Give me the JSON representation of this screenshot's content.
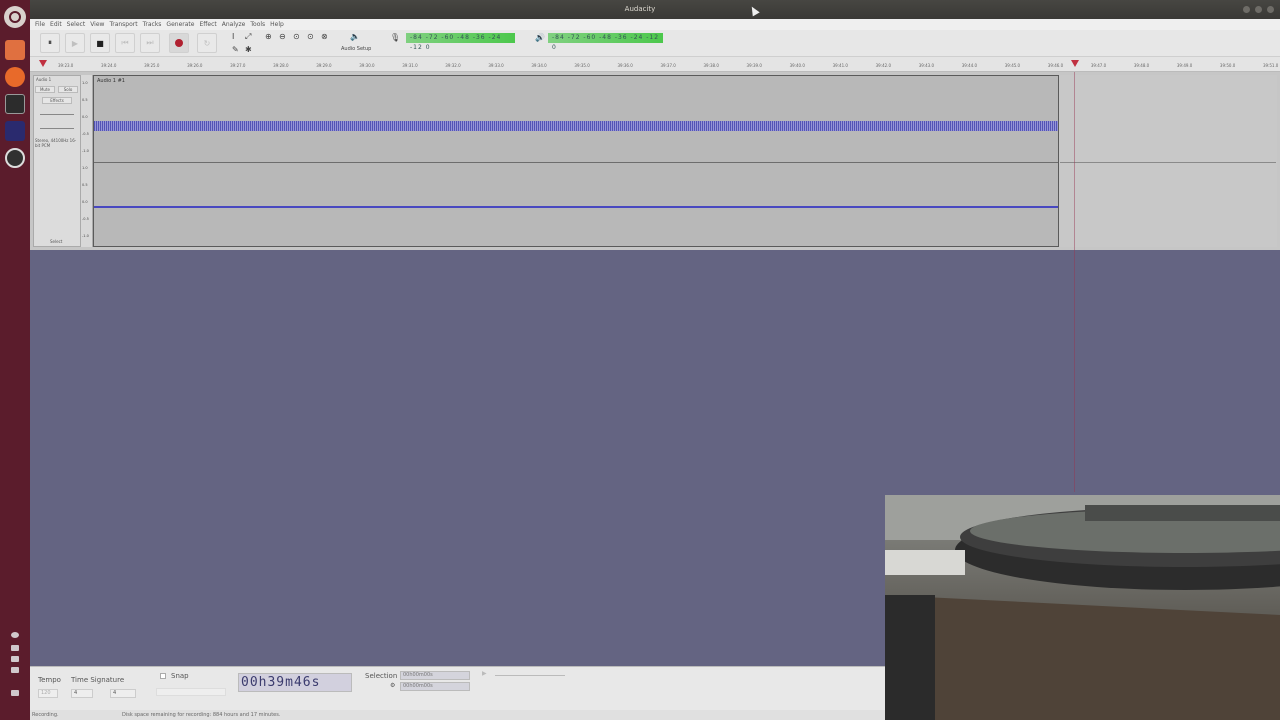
{
  "window": {
    "title": "Audacity"
  },
  "menubar": [
    "File",
    "Edit",
    "Select",
    "View",
    "Transport",
    "Tracks",
    "Generate",
    "Effect",
    "Analyze",
    "Tools",
    "Help"
  ],
  "toolbar": {
    "pause_icon": "⏸",
    "play_icon": "▶",
    "stop_icon": "■",
    "skip_start_icon": "⏮",
    "skip_end_icon": "⏭",
    "loop_icon": "↻",
    "audio_setup_label": "Audio Setup",
    "record_meter_ticks": "-84 -72 -60 -48 -36 -24 -12 0",
    "play_meter_ticks": "-84 -72 -60 -48 -36 -24 -12 0",
    "record_meter_level": 0.68,
    "play_meter_level": 0.72
  },
  "ruler": {
    "ticks": [
      "39:23.0",
      "39:24.0",
      "39:25.0",
      "39:26.0",
      "39:27.0",
      "39:28.0",
      "39:29.0",
      "39:30.0",
      "39:31.0",
      "39:32.0",
      "39:33.0",
      "39:34.0",
      "39:35.0",
      "39:36.0",
      "39:37.0",
      "39:38.0",
      "39:39.0",
      "39:40.0",
      "39:41.0",
      "39:42.0",
      "39:43.0",
      "39:44.0",
      "39:45.0",
      "39:46.0",
      "39:47.0",
      "39:48.0",
      "39:49.0",
      "39:50.0",
      "39:51.0"
    ]
  },
  "track": {
    "name": "Audio 1",
    "clip_name": "Audio 1 #1",
    "mute_label": "Mute",
    "solo_label": "Solo",
    "effects_label": "Effects",
    "info": "Stereo, 44100Hz 16-bit PCM",
    "select_label": "Select",
    "scale_labels": [
      "1.0",
      "0.5",
      "0.0",
      "-0.5",
      "-1.0",
      "1.0",
      "0.5",
      "0.0",
      "-0.5",
      "-1.0"
    ]
  },
  "selection_toolbar": {
    "tempo_label": "Tempo",
    "tempo_value": "120",
    "time_signature_label": "Time Signature",
    "ts_numerator": "4",
    "ts_denominator": "4",
    "snap_label": "Snap",
    "time_value": "00h39m46s",
    "selection_label": "Selection",
    "sel_start": "00h00m00s",
    "sel_end": "00h00m00s"
  },
  "status": {
    "state": "Recording.",
    "disk": "Disk space remaining for recording: 884 hours and 17 minutes."
  },
  "colors": {
    "launcher": "#5b1c2c",
    "waveform": "#3232b4",
    "meter": "#4cc84c",
    "desktop": "#646482"
  }
}
